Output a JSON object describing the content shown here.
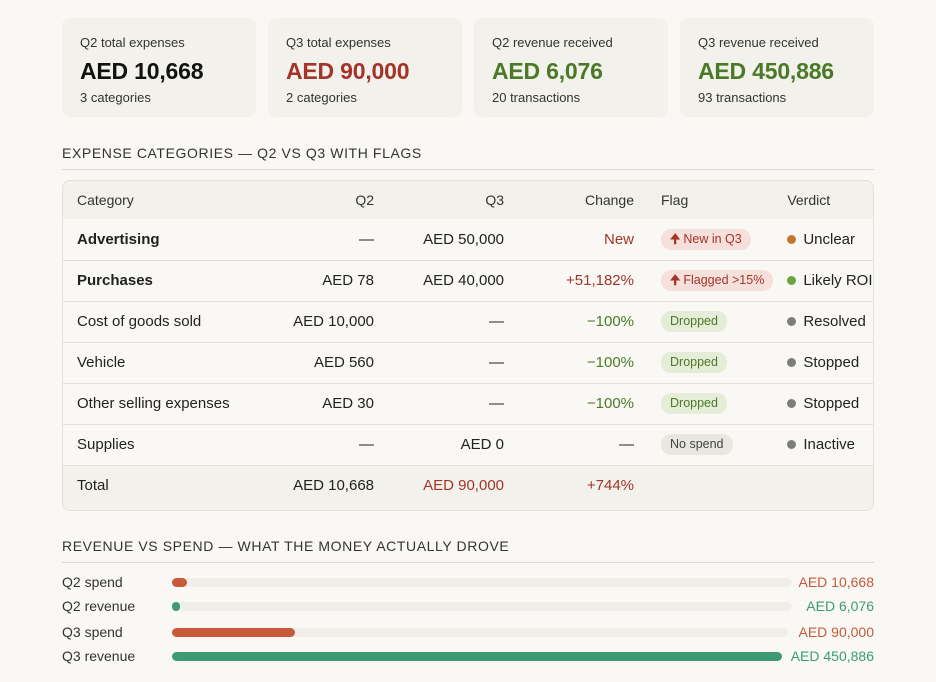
{
  "cards": [
    {
      "label": "Q2 total expenses",
      "value": "AED 10,668",
      "sub": "3 categories",
      "color": "#111111"
    },
    {
      "label": "Q3 total expenses",
      "value": "AED 90,000",
      "sub": "2 categories",
      "color": "#a33428"
    },
    {
      "label": "Q2 revenue received",
      "value": "AED 6,076",
      "sub": "20 transactions",
      "color": "#4a7a26"
    },
    {
      "label": "Q3 revenue received",
      "value": "AED 450,886",
      "sub": "93 transactions",
      "color": "#4a7a26"
    }
  ],
  "table_section": {
    "title": "EXPENSE CATEGORIES — Q2 VS Q3 WITH FLAGS",
    "headers": {
      "category": "Category",
      "q2": "Q2",
      "q3": "Q3",
      "change": "Change",
      "flag": "Flag",
      "verdict": "Verdict"
    },
    "rows": [
      {
        "category": "Advertising",
        "q2": "—",
        "q3": "AED 50,000",
        "change": "New",
        "flag": "New in Q3",
        "flag_icon": "arrow-up-icon",
        "verdict": "Unclear"
      },
      {
        "category": "Purchases",
        "q2": "AED 78",
        "q3": "AED 40,000",
        "change": "+51,182%",
        "flag": "Flagged >15%",
        "flag_icon": "arrow-up-icon",
        "verdict": "Likely ROI"
      },
      {
        "category": "Cost of goods sold",
        "q2": "AED 10,000",
        "q3": "—",
        "change": "−100%",
        "flag": "Dropped",
        "verdict": "Resolved"
      },
      {
        "category": "Vehicle",
        "q2": "AED 560",
        "q3": "—",
        "change": "−100%",
        "flag": "Dropped",
        "verdict": "Stopped"
      },
      {
        "category": "Other selling expenses",
        "q2": "AED 30",
        "q3": "—",
        "change": "−100%",
        "flag": "Dropped",
        "verdict": "Stopped"
      },
      {
        "category": "Supplies",
        "q2": "—",
        "q3": "AED 0",
        "change": "—",
        "flag": "No spend",
        "verdict": "Inactive"
      }
    ],
    "total": {
      "category": "Total",
      "q2": "AED 10,668",
      "q3": "AED 90,000",
      "change": "+744%"
    }
  },
  "bars_section": {
    "title": "REVENUE VS SPEND — WHAT THE MONEY ACTUALLY DROVE",
    "bars": [
      {
        "label": "Q2 spend",
        "value_text": "AED 10,668",
        "value": 10668,
        "kind": "spend"
      },
      {
        "label": "Q2 revenue",
        "value_text": "AED 6,076",
        "value": 6076,
        "kind": "revenue"
      },
      {
        "label": "Q3 spend",
        "value_text": "AED 90,000",
        "value": 90000,
        "kind": "spend"
      },
      {
        "label": "Q3 revenue",
        "value_text": "AED 450,886",
        "value": 450886,
        "kind": "revenue"
      }
    ],
    "max_value": 450886,
    "colors": {
      "spend": "#c65a3a",
      "revenue": "#3d9a72"
    }
  }
}
